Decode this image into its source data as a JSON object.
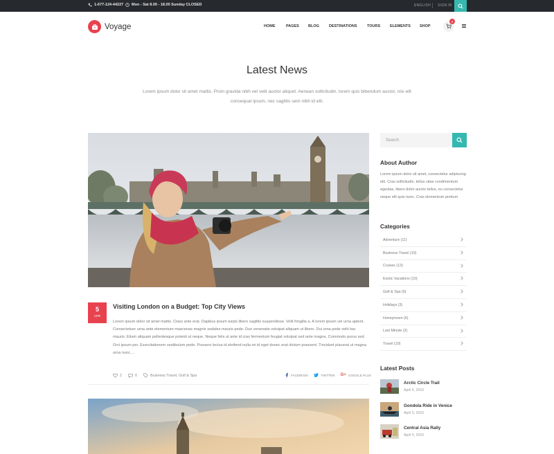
{
  "topbar": {
    "phone": "1-677-124-44227",
    "hours": "Mon - Sat 8.00 - 18.00 Sunday CLOSED",
    "language": "ENGLISH",
    "signin": "SIGN IN"
  },
  "header": {
    "logo_text": "Voyage",
    "nav": [
      "HOME",
      "PAGES",
      "BLOG",
      "DESTINATIONS",
      "TOURS",
      "ELEMENTS",
      "SHOP"
    ],
    "cart_count": "0"
  },
  "page": {
    "title": "Latest News",
    "description": "Lorem ipsum dolor sit amet mattis. Proin gravida nibh vel velit auctor aliquet. Aenean sollicitudin, lorem quis bibendum auctor, nisi elit consequat ipsum, nec sagittis sem nibh id elit."
  },
  "post": {
    "day": "5",
    "month": "APR",
    "title": "Visiting London on a Budget: Top City Views",
    "excerpt": "Lorem ipsum dolor sit amet mattis. Class ante erat. Dapibus ipsum turpis libero sagittis suspendisse. Velit fringilla a. A lorem ipsum vel urna aptent. Consectetuer urna ante elementum maecenas magnis sodales mauris pede. Duo venenatis volutpat aliquam ut libero. Dui urna pede velit hac mauris. Etiam aliquam pellentesque potenti ut neque. Neque felis ut ante id cras fermentum feugiat volutpat sed ante magna. Commodo purus sed. Orci ipsum per. Exercitationem vestibulum pede. Posuere lectus id eleifend nulla mi id eget donec erat dictum praesent. Tincidunt placerat ut magna urna nunc....",
    "likes": "2",
    "comments": "0",
    "tags": "Business Travel, Golf & Spa",
    "share": [
      "FACEBOOK",
      "TWITTER",
      "GOOGLE PLUS"
    ]
  },
  "sidebar": {
    "search_placeholder": "Search",
    "about_title": "About Author",
    "about_text": "Lorem ipsum dolor sit amet, consectetur adipiscing elit. Cras sollicitudin, tellus vitae condimentum egestas, libero dolor auctor tellus, eu consectetur neque elit quis nunc. Cras elementum pretium",
    "categories_title": "Categories",
    "categories": [
      "Adventure (11)",
      "Business Travel (10)",
      "Cruises (13)",
      "Exotic Vacations (10)",
      "Golf & Spa (6)",
      "Holidays (3)",
      "Honeymoon (6)",
      "Last Minute (2)",
      "Travel (10)"
    ],
    "latest_title": "Latest Posts",
    "latest": [
      {
        "title": "Arctic Circle Trail",
        "date": "April 5, 2016"
      },
      {
        "title": "Gondola Ride in Venice",
        "date": "April 5, 2016"
      },
      {
        "title": "Central Asia Rally",
        "date": "April 5, 2016"
      }
    ]
  },
  "colors": {
    "accent": "#e8424f",
    "teal": "#35b8b0",
    "topbar": "#262a2e"
  }
}
